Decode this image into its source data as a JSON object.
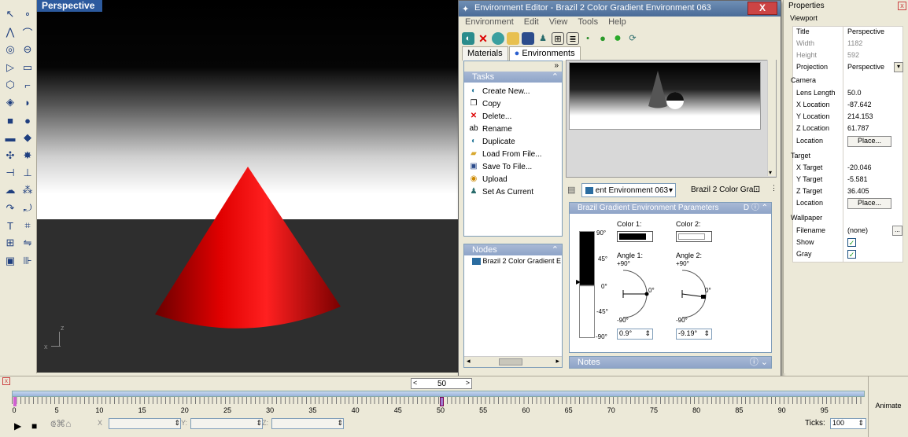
{
  "viewport": {
    "label": "Perspective",
    "axis_x": "x",
    "axis_z": "z"
  },
  "env_editor": {
    "title": "Environment Editor - Brazil 2 Color Gradient Environment 063",
    "close": "X",
    "menu": [
      "Environment",
      "Edit",
      "View",
      "Tools",
      "Help"
    ],
    "tabs": [
      "Materials",
      "Environments"
    ],
    "tasks_title": "Tasks",
    "tasks": [
      "Create New...",
      "Copy",
      "Delete...",
      "Rename",
      "Duplicate",
      "Load From File...",
      "Save To File...",
      "Upload",
      "Set As Current"
    ],
    "nodes_title": "Nodes",
    "node_item": "Brazil 2 Color Gradient E",
    "env_select": "ent Environment 063",
    "env_name": "Brazil 2 Color Gra...",
    "params_title": "Brazil Gradient Environment Parameters",
    "color1_label": "Color 1:",
    "color2_label": "Color 2:",
    "angle1_label": "Angle 1:",
    "angle2_label": "Angle 2:",
    "angle1_value": "0.9°",
    "angle2_value": "-9.19°",
    "plus90": "+90°",
    "minus90": "-90°",
    "zero": "0°",
    "scale_labels": [
      "90°",
      "45°",
      "0°",
      "-45°",
      "-90°"
    ],
    "notes_title": "Notes",
    "colors": {
      "color1": "#000000",
      "color2": "#ffffff"
    }
  },
  "properties": {
    "title": "Properties",
    "viewport_section": "Viewport",
    "rows_viewport": [
      {
        "k": "Title",
        "v": "Perspective"
      },
      {
        "k": "Width",
        "v": "1182"
      },
      {
        "k": "Height",
        "v": "592"
      },
      {
        "k": "Projection",
        "v": "Perspective"
      }
    ],
    "camera_section": "Camera",
    "rows_camera": [
      {
        "k": "Lens Length",
        "v": "50.0"
      },
      {
        "k": "X Location",
        "v": "-87.642"
      },
      {
        "k": "Y Location",
        "v": "214.153"
      },
      {
        "k": "Z Location",
        "v": "61.787"
      },
      {
        "k": "Location",
        "v": "Place..."
      }
    ],
    "target_section": "Target",
    "rows_target": [
      {
        "k": "X Target",
        "v": "-20.046"
      },
      {
        "k": "Y Target",
        "v": "-5.581"
      },
      {
        "k": "Z Target",
        "v": "36.405"
      },
      {
        "k": "Location",
        "v": "Place..."
      }
    ],
    "wallpaper_section": "Wallpaper",
    "rows_wallpaper": [
      {
        "k": "Filename",
        "v": "(none)"
      },
      {
        "k": "Show",
        "v": "✓"
      },
      {
        "k": "Gray",
        "v": "✓"
      }
    ]
  },
  "timeline": {
    "frame": "50",
    "ticks": [
      "0",
      "5",
      "10",
      "15",
      "20",
      "25",
      "30",
      "35",
      "40",
      "45",
      "50",
      "55",
      "60",
      "65",
      "70",
      "75",
      "80",
      "85",
      "90",
      "95"
    ],
    "ticks_label": "Ticks:",
    "ticks_value": "100",
    "animate": "Animate",
    "x_label": "X",
    "y_label": "Y:",
    "z_label": "Z:"
  }
}
